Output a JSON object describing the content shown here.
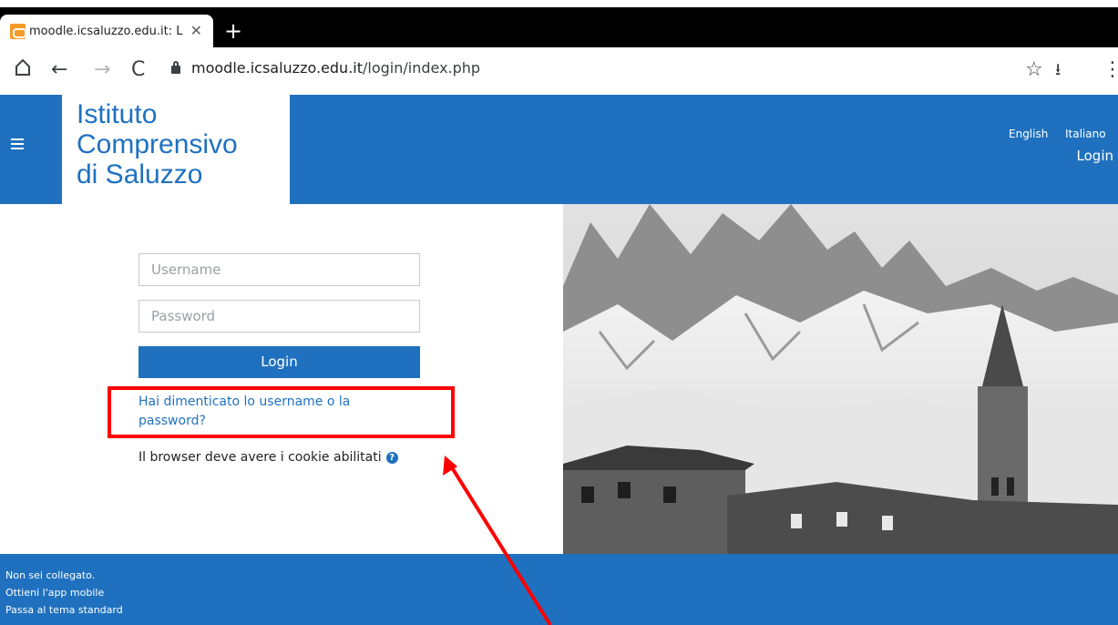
{
  "browser": {
    "tab_title": "moodle.icsaluzzo.edu.it: L",
    "url_host": "moodle.icsaluzzo.edu.it",
    "url_path": "/login/index.php"
  },
  "header": {
    "logo_lines": [
      "Istituto",
      "Comprensivo",
      "di Saluzzo"
    ],
    "languages": [
      "English",
      "Italiano"
    ],
    "login_link": "Login"
  },
  "form": {
    "username_placeholder": "Username",
    "password_placeholder": "Password",
    "login_button": "Login",
    "forgot_link": "Hai dimenticato lo username o la password?",
    "cookie_notice": "Il browser deve avere i cookie abilitati"
  },
  "footer": {
    "lines": [
      "Non sei collegato.",
      "Ottieni l'app mobile",
      "Passa al tema standard"
    ]
  },
  "colors": {
    "brand": "#1f71bf",
    "annotation": "#ff0000"
  }
}
